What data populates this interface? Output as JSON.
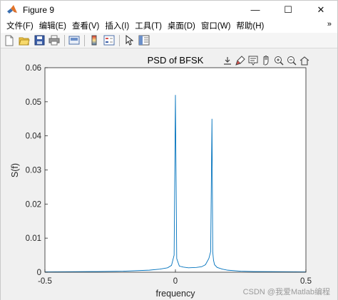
{
  "window": {
    "title": "Figure 9",
    "minimize": "—",
    "maximize": "☐",
    "close": "✕"
  },
  "menubar": {
    "items": [
      {
        "label": "文件(F)"
      },
      {
        "label": "编辑(E)"
      },
      {
        "label": "查看(V)"
      },
      {
        "label": "插入(I)"
      },
      {
        "label": "工具(T)"
      },
      {
        "label": "桌面(D)"
      },
      {
        "label": "窗口(W)"
      },
      {
        "label": "帮助(H)"
      }
    ],
    "more": "»"
  },
  "toolbar": {
    "icons": [
      "new-figure-icon",
      "open-file-icon",
      "save-icon",
      "print-icon",
      "link-plot-icon",
      "insert-colorbar-icon",
      "insert-legend-icon",
      "edit-plot-arrow-icon",
      "property-inspector-icon"
    ]
  },
  "axes_toolbar": {
    "icons": [
      "export-icon",
      "brush-icon",
      "data-tips-icon",
      "pan-icon",
      "zoom-in-icon",
      "zoom-out-icon",
      "home-icon"
    ]
  },
  "watermark": "CSDN @我爱Matlab编程",
  "chart_data": {
    "type": "line",
    "title": "PSD of BFSK",
    "xlabel": "frequency",
    "ylabel": "S(f)",
    "xlim": [
      -0.5,
      0.5
    ],
    "ylim": [
      0,
      0.06
    ],
    "xticks": [
      "-0.5",
      "0",
      "0.5"
    ],
    "yticks": [
      "0",
      "0.01",
      "0.02",
      "0.03",
      "0.04",
      "0.05",
      "0.06"
    ],
    "grid": false,
    "line_color": "#0072bd",
    "series": [
      {
        "x": [
          -0.5,
          -0.3,
          -0.2,
          -0.1,
          -0.06,
          -0.03,
          -0.015,
          -0.005,
          0.0,
          0.005,
          0.015,
          0.03,
          0.05,
          0.08,
          0.1,
          0.115,
          0.128,
          0.135,
          0.14,
          0.143,
          0.146,
          0.15,
          0.16,
          0.18,
          0.2,
          0.25,
          0.3,
          0.5
        ],
        "values": [
          0.0001,
          0.0002,
          0.0003,
          0.0006,
          0.0009,
          0.0013,
          0.002,
          0.005,
          0.052,
          0.004,
          0.0018,
          0.0015,
          0.0013,
          0.0014,
          0.0016,
          0.0022,
          0.004,
          0.006,
          0.045,
          0.006,
          0.0035,
          0.0022,
          0.0014,
          0.0009,
          0.0006,
          0.0003,
          0.0002,
          0.0001
        ]
      }
    ]
  }
}
